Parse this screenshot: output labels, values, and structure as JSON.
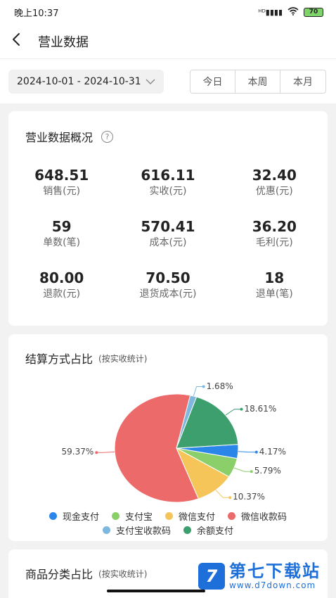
{
  "status": {
    "time": "晚上10:37",
    "signal": "ᴴᴰ▮▮▮▮",
    "battery": "70"
  },
  "header": {
    "title": "营业数据"
  },
  "filter": {
    "date_range": "2024-10-01 - 2024-10-31",
    "tabs": [
      "今日",
      "本周",
      "本月"
    ]
  },
  "overview": {
    "title": "营业数据概况",
    "help": "?",
    "metrics": [
      {
        "value": "648.51",
        "label": "销售(元)"
      },
      {
        "value": "616.11",
        "label": "实收(元)"
      },
      {
        "value": "32.40",
        "label": "优惠(元)"
      },
      {
        "value": "59",
        "label": "单数(笔)"
      },
      {
        "value": "570.41",
        "label": "成本(元)"
      },
      {
        "value": "36.20",
        "label": "毛利(元)"
      },
      {
        "value": "80.00",
        "label": "退款(元)"
      },
      {
        "value": "70.50",
        "label": "退货成本(元)"
      },
      {
        "value": "18",
        "label": "退单(笔)"
      }
    ]
  },
  "settlement": {
    "title": "结算方式占比",
    "subtitle": "(按实收统计)"
  },
  "chart_data": {
    "type": "pie",
    "title": "结算方式占比",
    "subtitle": "(按实收统计)",
    "legend_position": "bottom",
    "slices": [
      {
        "name": "现金支付",
        "value": 4.17,
        "label": "4.17%",
        "color": "#2b86ea"
      },
      {
        "name": "支付宝",
        "value": 5.79,
        "label": "5.79%",
        "color": "#8bcf6a"
      },
      {
        "name": "微信支付",
        "value": 10.37,
        "label": "10.37%",
        "color": "#f5c55a"
      },
      {
        "name": "微信收款码",
        "value": 59.37,
        "label": "59.37%",
        "color": "#ec6a6a"
      },
      {
        "name": "支付宝收款码",
        "value": 1.68,
        "label": "1.68%",
        "color": "#7fb8de"
      },
      {
        "name": "余额支付",
        "value": 18.61,
        "label": "18.61%",
        "color": "#3e9f6e"
      }
    ]
  },
  "category": {
    "title": "商品分类占比",
    "subtitle": "(按实收统计)"
  },
  "watermark": {
    "logo": "7",
    "name": "第七下载站",
    "url": "www.d7down.com"
  }
}
